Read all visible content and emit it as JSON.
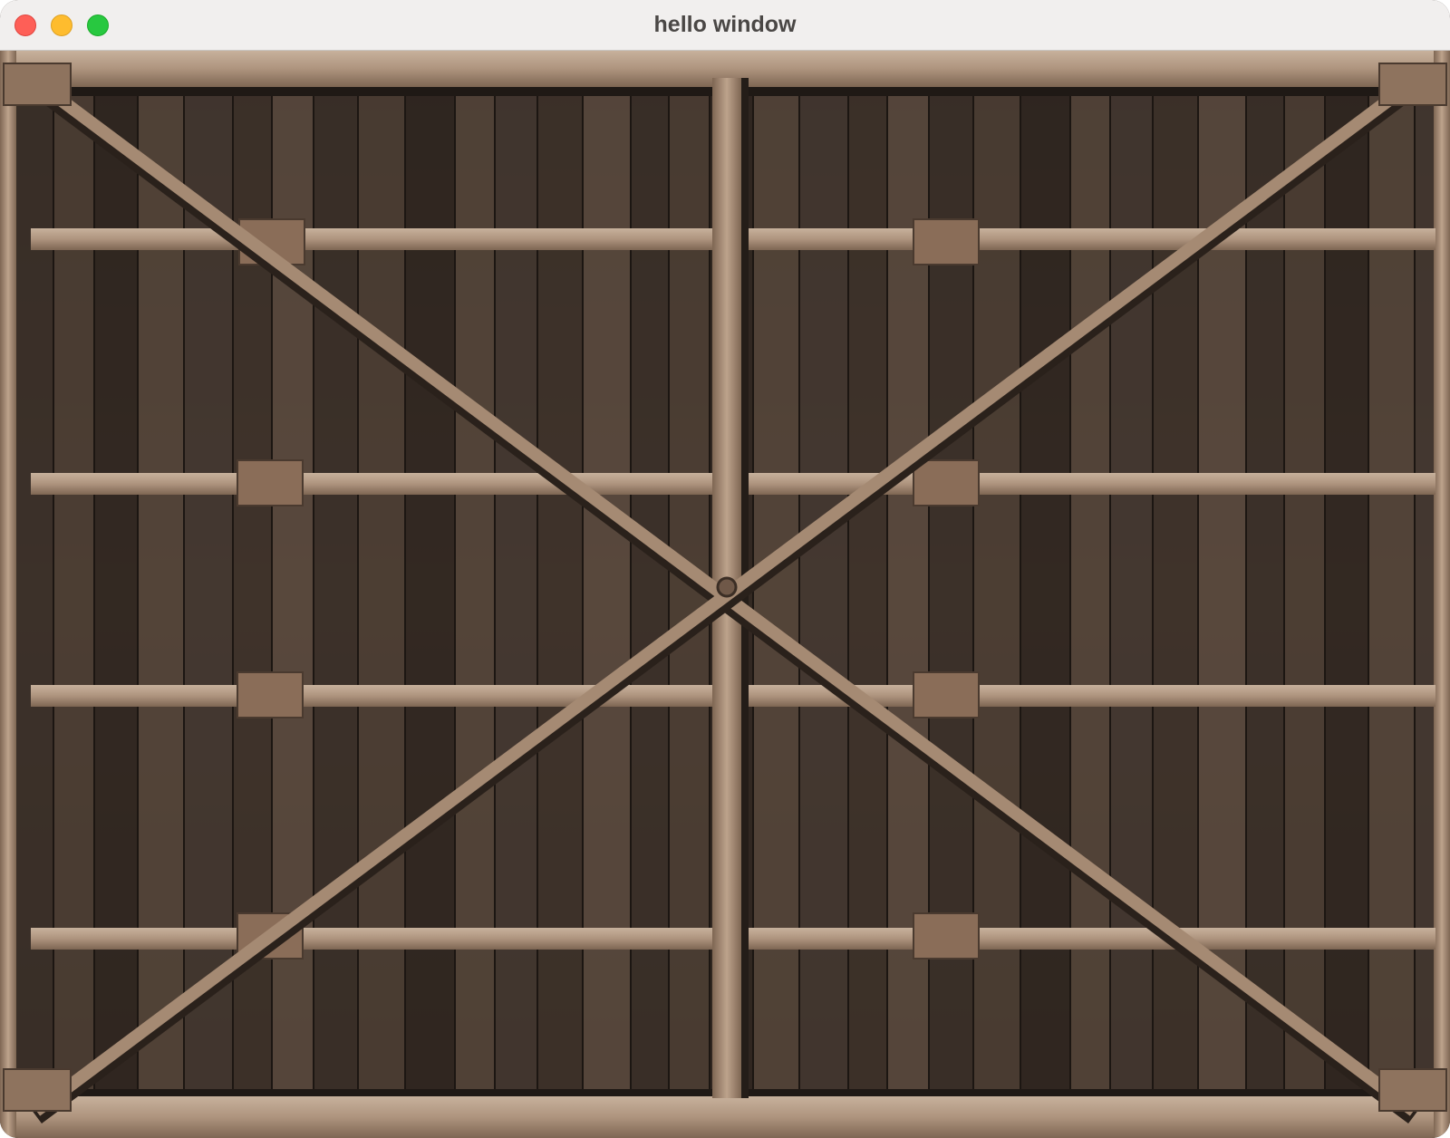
{
  "window": {
    "title": "hello window",
    "controls": [
      "close",
      "minimize",
      "zoom"
    ]
  },
  "content": {
    "image": "wooden-barn-door-texture",
    "colors": {
      "plank_dark": "#3b3029",
      "plank_mid": "#5a4a3e",
      "beam": "#b39a84",
      "beam_shadow": "#7d6552",
      "rust": "#a8673f"
    }
  }
}
